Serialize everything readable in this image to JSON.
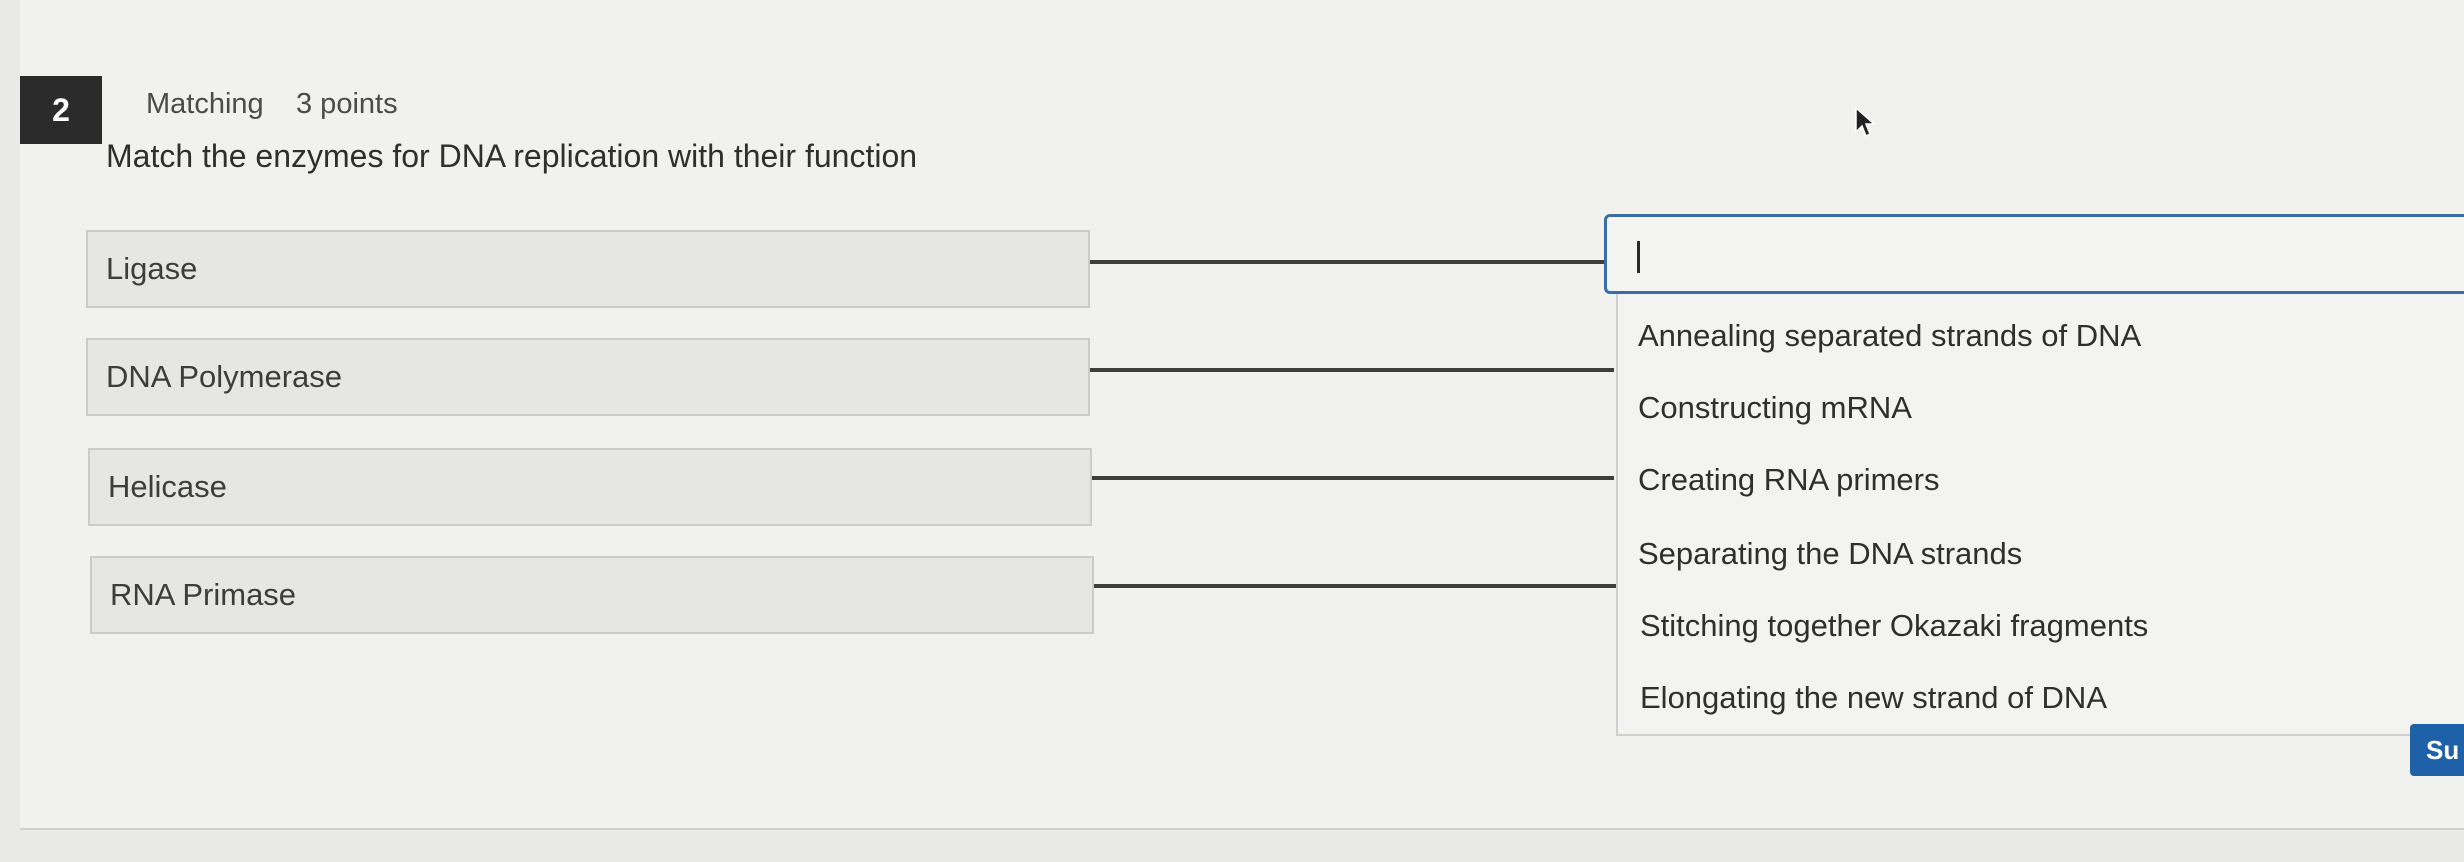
{
  "question": {
    "number": "2",
    "type": "Matching",
    "points": "3 points",
    "prompt": "Match the enzymes for DNA replication with their function"
  },
  "terms": [
    "Ligase",
    "DNA Polymerase",
    "Helicase",
    "RNA Primase"
  ],
  "answer_field": {
    "value": ""
  },
  "options": [
    "Annealing separated strands of DNA",
    "Constructing mRNA",
    "Creating RNA primers",
    "Separating the DNA strands",
    "Stitching together Okazaki fragments",
    "Elongating the new strand of DNA"
  ],
  "submit_label": "Su",
  "icons": {
    "cursor": "mouse-pointer-icon"
  },
  "colors": {
    "accent": "#3a6ca7",
    "submit": "#1f61a8",
    "badge": "#2b2b2b"
  }
}
